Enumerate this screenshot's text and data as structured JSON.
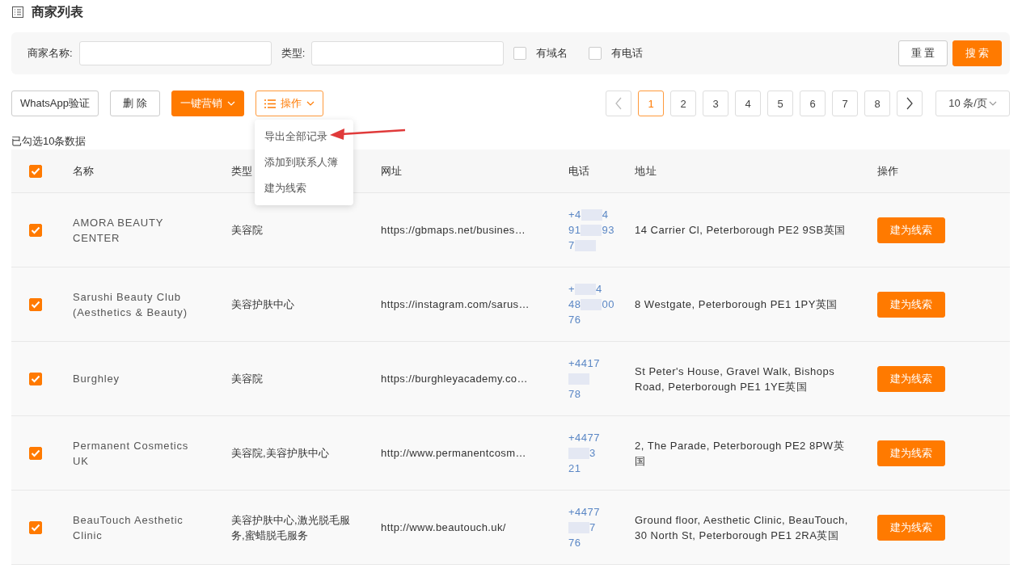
{
  "page": {
    "title": "商家列表"
  },
  "filters": {
    "fields": [
      {
        "label": "商家名称:"
      },
      {
        "label": "类型:"
      }
    ],
    "checkboxes": [
      {
        "label": "有域名",
        "checked": false
      },
      {
        "label": "有电话",
        "checked": false
      }
    ],
    "buttons": [
      {
        "label": "重 置",
        "kind": "plain"
      },
      {
        "label": "搜 索",
        "kind": "primary"
      }
    ]
  },
  "toolbar": {
    "buttons": [
      {
        "label": "WhatsApp验证",
        "kind": "plain"
      },
      {
        "label": "删 除",
        "kind": "plain"
      },
      {
        "label": "一键营销",
        "kind": "primary-dropdown"
      },
      {
        "label": "操作",
        "kind": "outline-dropdown"
      }
    ],
    "menu": [
      {
        "label": "导出全部记录"
      },
      {
        "label": "添加到联系人簿"
      },
      {
        "label": "建为线索"
      }
    ]
  },
  "pagination": {
    "pages": [
      {
        "label": "1",
        "selected": true
      },
      {
        "label": "2",
        "selected": false
      },
      {
        "label": "3",
        "selected": false
      },
      {
        "label": "4",
        "selected": false
      },
      {
        "label": "5",
        "selected": false
      },
      {
        "label": "6",
        "selected": false
      },
      {
        "label": "7",
        "selected": false
      },
      {
        "label": "8",
        "selected": false
      }
    ],
    "prev_disabled": true,
    "page_size": "10 条/页"
  },
  "selection_info": "已勾选10条数据",
  "table": {
    "all_checked": true,
    "columns": [
      "名称",
      "类型",
      "网址",
      "电话",
      "地址",
      "操作"
    ],
    "rows": [
      {
        "checked": true,
        "name": "AMORA BEAUTY CENTER",
        "type": "美容院",
        "url": "https://gbmaps.net/busines…",
        "phone": [
          [
            {
              "kind": "text",
              "text": "+4"
            },
            {
              "kind": "blur"
            },
            {
              "kind": "text",
              "text": "4"
            }
          ],
          [
            {
              "kind": "text",
              "text": "91"
            },
            {
              "kind": "blur"
            },
            {
              "kind": "text",
              "text": "93"
            }
          ],
          [
            {
              "kind": "text",
              "text": "7"
            },
            {
              "kind": "blur"
            }
          ]
        ],
        "address": "14 Carrier Cl, Peterborough PE2 9SB英国",
        "action": "建为线索"
      },
      {
        "checked": true,
        "name": "Sarushi Beauty Club (Aesthetics & Beauty)",
        "type": "美容护肤中心",
        "url": "https://instagram.com/sarus…",
        "phone": [
          [
            {
              "kind": "text",
              "text": "+"
            },
            {
              "kind": "blur"
            },
            {
              "kind": "text",
              "text": "4"
            }
          ],
          [
            {
              "kind": "text",
              "text": "48"
            },
            {
              "kind": "blur"
            },
            {
              "kind": "text",
              "text": "00"
            }
          ],
          [
            {
              "kind": "text",
              "text": "76"
            }
          ]
        ],
        "address": "8 Westgate, Peterborough PE1 1PY英国",
        "action": "建为线索"
      },
      {
        "checked": true,
        "name": "Burghley",
        "type": "美容院",
        "url": "https://burghleyacademy.co…",
        "phone": [
          [
            {
              "kind": "text",
              "text": "+4417"
            }
          ],
          [
            {
              "kind": "blur"
            }
          ],
          [
            {
              "kind": "text",
              "text": "78"
            }
          ]
        ],
        "address": "St Peter's House, Gravel Walk, Bishops Road, Peterborough PE1 1YE英国",
        "action": "建为线索"
      },
      {
        "checked": true,
        "name": "Permanent Cosmetics UK",
        "type": "美容院,美容护肤中心",
        "url": "http://www.permanentcosm…",
        "phone": [
          [
            {
              "kind": "text",
              "text": "+4477"
            }
          ],
          [
            {
              "kind": "blur"
            },
            {
              "kind": "text",
              "text": "3"
            }
          ],
          [
            {
              "kind": "text",
              "text": "21"
            }
          ]
        ],
        "address": "2, The Parade, Peterborough PE2 8PW英国",
        "action": "建为线索"
      },
      {
        "checked": true,
        "name": "BeauTouch Aesthetic Clinic",
        "type": "美容护肤中心,激光脱毛服务,蜜蜡脱毛服务",
        "url": "http://www.beautouch.uk/",
        "phone": [
          [
            {
              "kind": "text",
              "text": "+4477"
            }
          ],
          [
            {
              "kind": "blur"
            },
            {
              "kind": "text",
              "text": "7"
            }
          ],
          [
            {
              "kind": "text",
              "text": "76"
            }
          ]
        ],
        "address": "Ground floor, Aesthetic Clinic, BeauTouch, 30 North St, Peterborough PE1 2RA英国",
        "action": "建为线索"
      }
    ]
  }
}
